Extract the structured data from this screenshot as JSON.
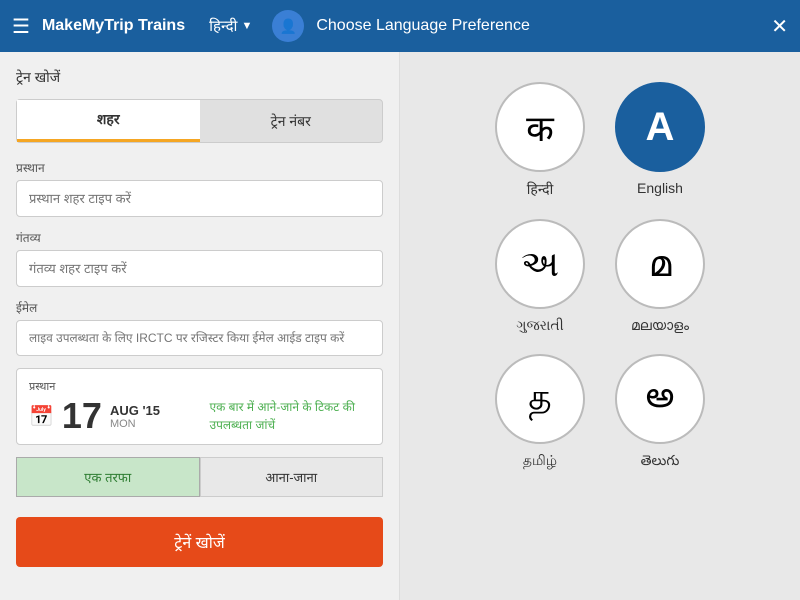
{
  "header": {
    "menu_label": "☰",
    "logo": "MakeMyTrip Trains",
    "lang_current": "हिन्दी",
    "profile_icon": "👤",
    "title": "Choose Language Preference",
    "close_icon": "✕"
  },
  "left": {
    "section_title": "ट्रेन खोजें",
    "tabs": [
      {
        "label": "शहर",
        "active": true
      },
      {
        "label": "ट्रेन नंबर",
        "active": false
      }
    ],
    "departure_label": "प्रस्थान",
    "departure_placeholder": "प्रस्थान शहर टाइप करें",
    "destination_label": "गंतव्य",
    "destination_placeholder": "गंतव्य शहर टाइप करें",
    "email_label": "ईमेल",
    "email_placeholder": "लाइव उपलब्धता के लिए IRCTC पर रजिस्टर किया ईमेल आईड टाइप करें",
    "date_section_label": "प्रस्थान",
    "date_day": "17",
    "date_month": "AUG '15",
    "date_dow": "MON",
    "round_trip_text": "एक बार में आने-जाने के टिकट की उपलब्धता जांचें",
    "journey_tabs": [
      {
        "label": "एक तरफा",
        "active": true
      },
      {
        "label": "आना-जाना",
        "active": false
      }
    ],
    "search_btn": "ट्रेनें खोजें"
  },
  "languages": [
    {
      "symbol": "क",
      "name": "हिन्दी",
      "selected": false
    },
    {
      "symbol": "A",
      "name": "English",
      "selected": true
    },
    {
      "symbol": "અ",
      "name": "ગુજરાતી",
      "selected": false
    },
    {
      "symbol": "മ",
      "name": "മലയാളം",
      "selected": false
    },
    {
      "symbol": "த",
      "name": "தமிழ்",
      "selected": false
    },
    {
      "symbol": "అ",
      "name": "తెలుగు",
      "selected": false
    }
  ]
}
